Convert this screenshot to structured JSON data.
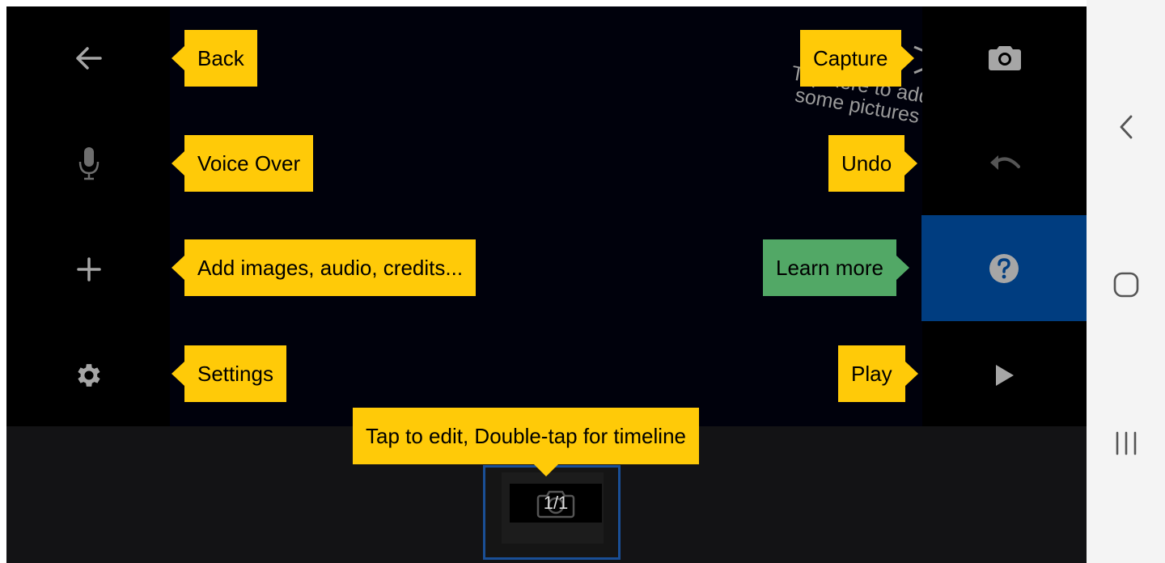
{
  "toolbar_left": [
    {
      "name": "back-icon"
    },
    {
      "name": "microphone-icon"
    },
    {
      "name": "add-icon"
    },
    {
      "name": "settings-gear-icon"
    }
  ],
  "toolbar_right": [
    {
      "name": "camera-icon"
    },
    {
      "name": "undo-icon"
    },
    {
      "name": "help-icon"
    },
    {
      "name": "play-icon"
    }
  ],
  "canvas": {
    "hint_line1": "Tap here to add",
    "hint_line2": "some pictures"
  },
  "tooltips": {
    "back": "Back",
    "voice_over": "Voice Over",
    "add": "Add images, audio, credits...",
    "settings": "Settings",
    "capture": "Capture",
    "undo": "Undo",
    "learn_more": "Learn more",
    "play": "Play",
    "timeline": "Tap to edit, Double-tap for timeline"
  },
  "timeline": {
    "frame_count": "1/1"
  },
  "colors": {
    "tooltip_yellow": "#ffca08",
    "tooltip_green": "#52a866",
    "help_panel_blue": "#003d80",
    "thumb_border_blue": "#1a4f96"
  },
  "system_nav": [
    {
      "name": "nav-back-icon"
    },
    {
      "name": "nav-home-icon"
    },
    {
      "name": "nav-recents-icon"
    }
  ]
}
